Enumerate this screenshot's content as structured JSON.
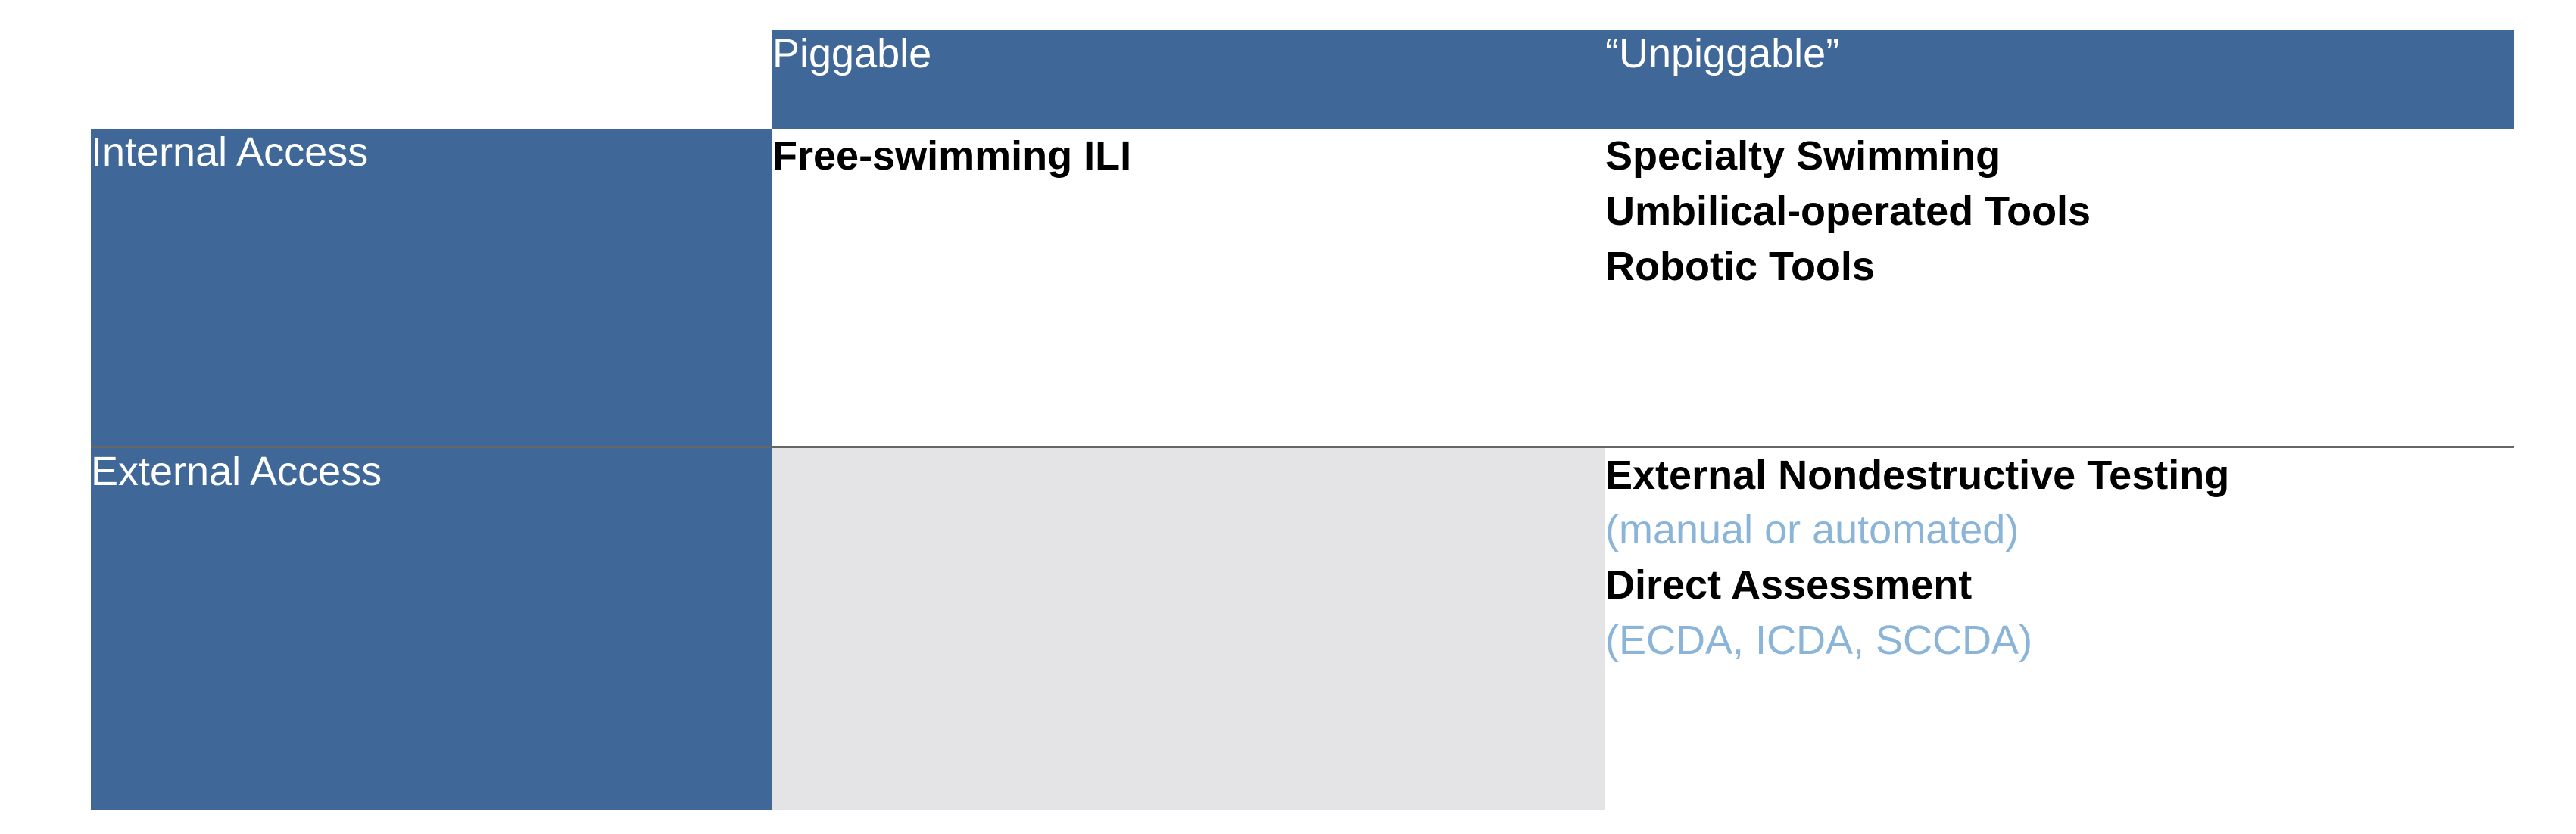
{
  "table": {
    "columns": {
      "piggable": "Piggable",
      "unpiggable": "“Unpiggable”"
    },
    "rows": {
      "internal": {
        "label": "Internal Access",
        "piggable": "Free-swimming ILI",
        "unpiggable_line1": "Specialty Swimming",
        "unpiggable_line2": "Umbilical-operated Tools",
        "unpiggable_line3": "Robotic Tools"
      },
      "external": {
        "label": "External Access",
        "piggable": "",
        "unpiggable_line1": "External Nondestructive Testing",
        "unpiggable_sub1": "(manual or automated)",
        "unpiggable_line2": "Direct Assessment",
        "unpiggable_sub2": "(ECDA, ICDA, SCCDA)"
      }
    }
  },
  "chart_data": {
    "type": "table",
    "title": "",
    "columns": [
      "",
      "Piggable",
      "\"Unpiggable\""
    ],
    "rows": [
      {
        "label": "Internal Access",
        "Piggable": "Free-swimming ILI",
        "Unpiggable": "Specialty Swimming; Umbilical-operated Tools; Robotic Tools"
      },
      {
        "label": "External Access",
        "Piggable": "",
        "Unpiggable": "External Nondestructive Testing (manual or automated); Direct Assessment (ECDA, ICDA, SCCDA)"
      }
    ]
  }
}
